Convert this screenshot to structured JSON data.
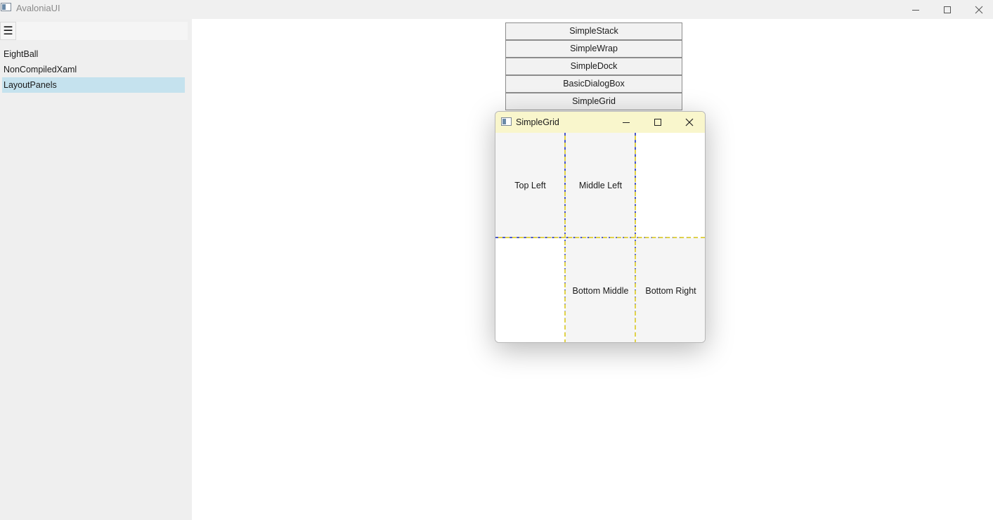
{
  "app": {
    "title": "AvaloniaUI"
  },
  "sidebar": {
    "menu_icon": "☰",
    "items": [
      {
        "label": "EightBall",
        "selected": false
      },
      {
        "label": "NonCompiledXaml",
        "selected": false
      },
      {
        "label": "LayoutPanels",
        "selected": true
      }
    ]
  },
  "buttons": [
    {
      "label": "SimpleStack"
    },
    {
      "label": "SimpleWrap"
    },
    {
      "label": "SimpleDock"
    },
    {
      "label": "BasicDialogBox"
    },
    {
      "label": "SimpleGrid"
    }
  ],
  "dialog": {
    "title": "SimpleGrid",
    "cells": {
      "top_left": "Top Left",
      "middle_left": "Middle Left",
      "bottom_middle": "Bottom Middle",
      "bottom_right": "Bottom Right"
    }
  },
  "colors": {
    "selected_item": "#c5e2ee",
    "dialog_titlebar": "#f9f6cc",
    "grid_line_a": "#4a57c8",
    "grid_line_b": "#e0d24a"
  }
}
